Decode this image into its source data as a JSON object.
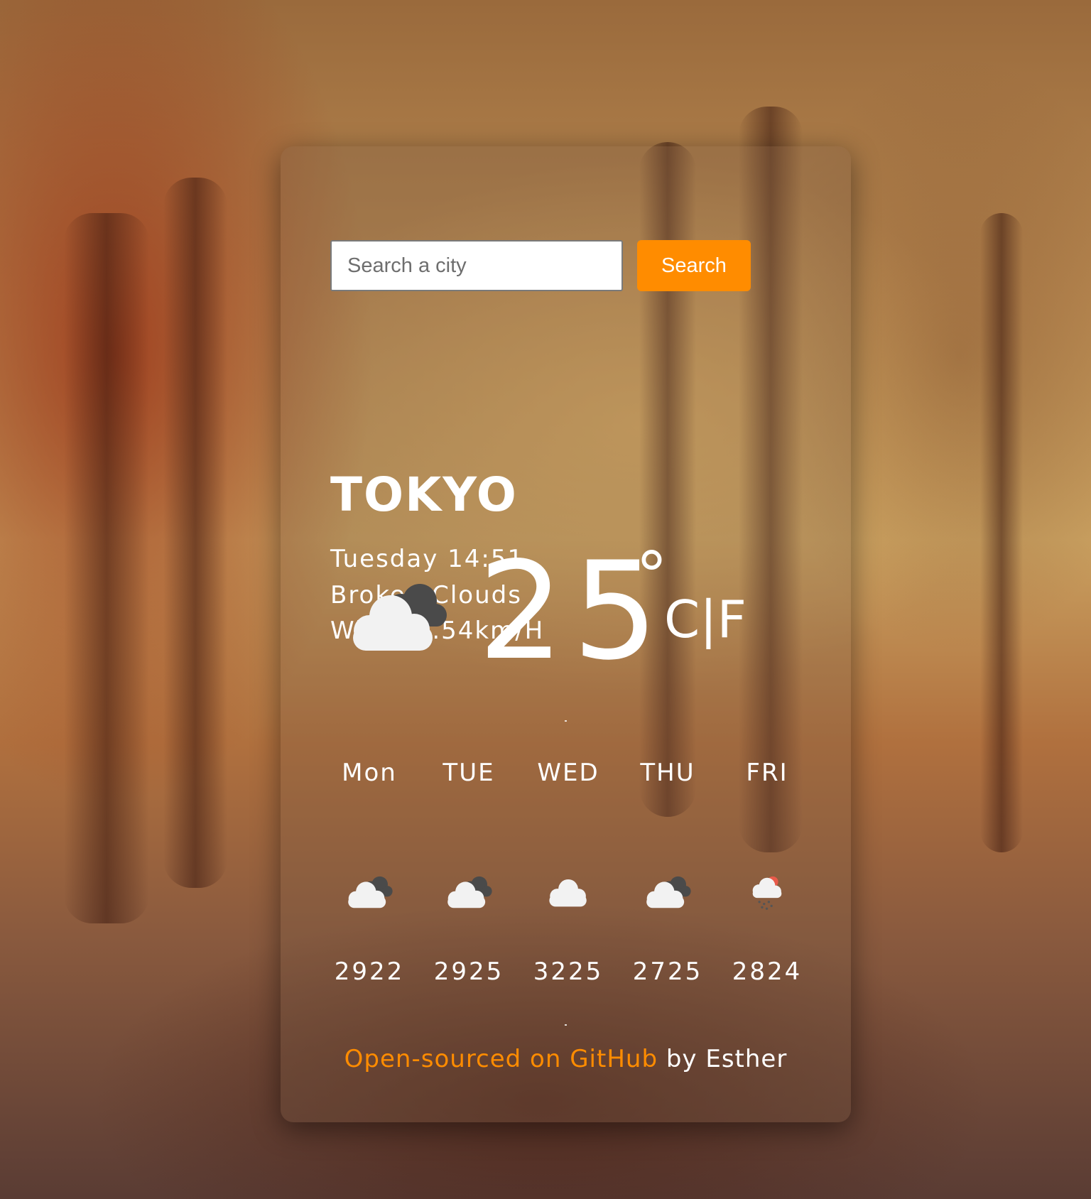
{
  "search": {
    "placeholder": "Search a city",
    "button_label": "Search"
  },
  "current": {
    "city": "TOKYO",
    "datetime": "Tuesday 14:51",
    "description": "Broken Clouds",
    "wind": "Wind: 1.54km/H",
    "temperature": "25",
    "degree_symbol": "°",
    "unit_celsius": "C",
    "unit_separator": "|",
    "unit_fahrenheit": "F",
    "icon": "broken-clouds-icon"
  },
  "forecast": [
    {
      "day": "Mon",
      "temps": "2922",
      "icon": "broken-clouds-icon"
    },
    {
      "day": "TUE",
      "temps": "2925",
      "icon": "broken-clouds-icon"
    },
    {
      "day": "WED",
      "temps": "3225",
      "icon": "few-clouds-icon"
    },
    {
      "day": "THU",
      "temps": "2725",
      "icon": "broken-clouds-icon"
    },
    {
      "day": "FRI",
      "temps": "2824",
      "icon": "rain-icon"
    }
  ],
  "footer": {
    "link_text": "Open-sourced on GitHub",
    "suffix": " by Esther"
  },
  "colors": {
    "accent": "#ff8c00",
    "text": "#ffffff"
  }
}
